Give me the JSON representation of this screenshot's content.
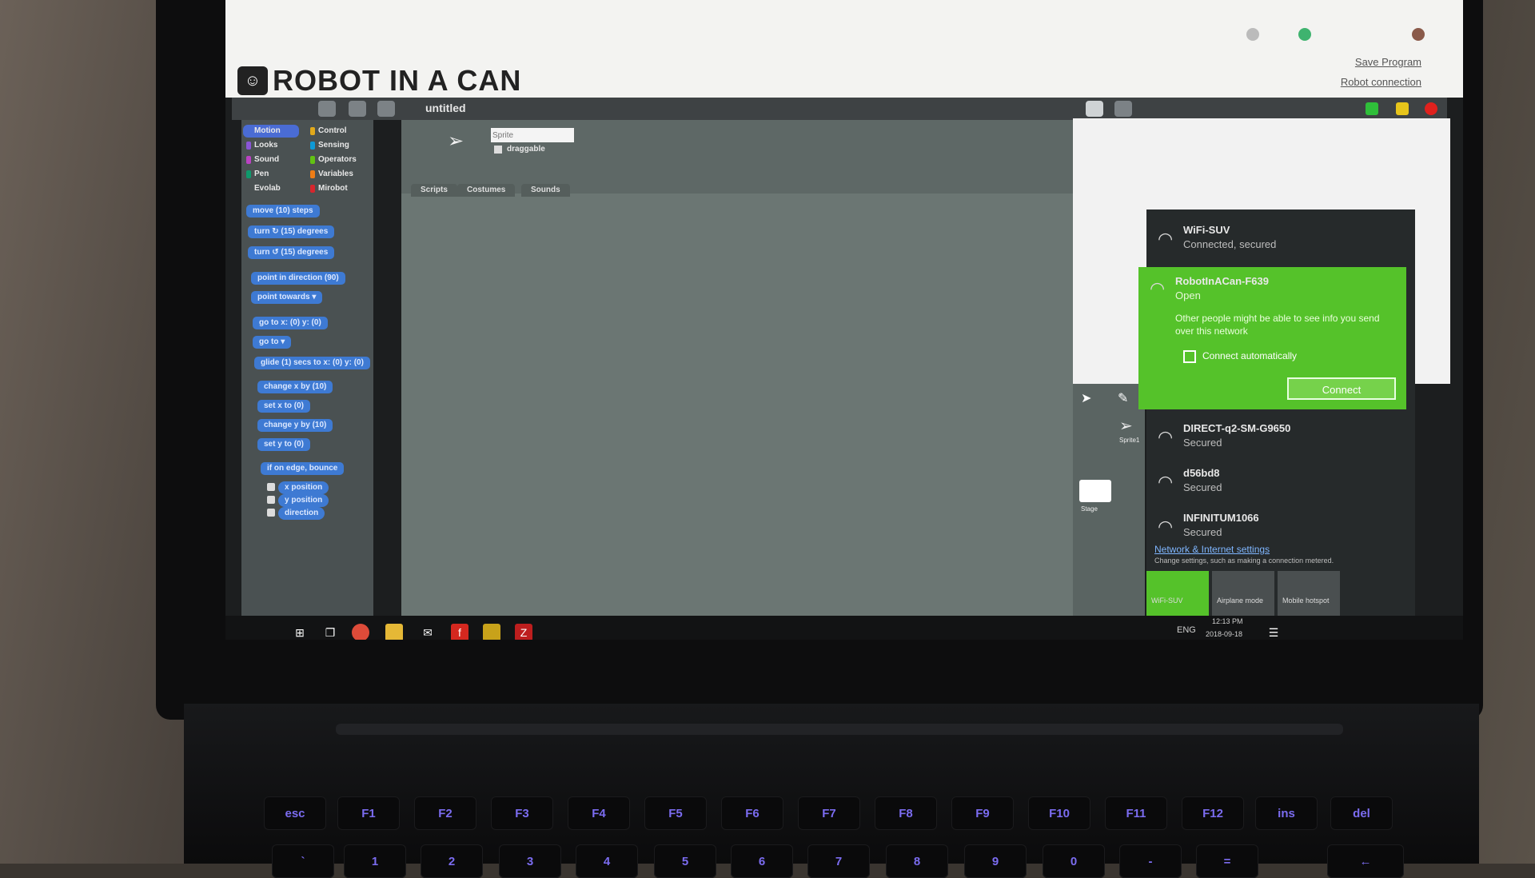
{
  "browser": {
    "logo_text": "ROBOT IN A CAN",
    "save_program": "Save Program",
    "connection_link": "Robot connection"
  },
  "app": {
    "project_title": "untitled",
    "sprite_name_placeholder": "Sprite",
    "draggable_label": "draggable",
    "tabs": [
      "Scripts",
      "Costumes",
      "Sounds"
    ],
    "categories": [
      {
        "label": "Motion",
        "color": "#4a6cd4"
      },
      {
        "label": "Control",
        "color": "#e1a91a"
      },
      {
        "label": "Looks",
        "color": "#8a55d7"
      },
      {
        "label": "Sensing",
        "color": "#0e9ad6"
      },
      {
        "label": "Sound",
        "color": "#bb42c3"
      },
      {
        "label": "Operators",
        "color": "#62c213"
      },
      {
        "label": "Pen",
        "color": "#0e9a6c"
      },
      {
        "label": "Variables",
        "color": "#ee7d16"
      },
      {
        "label": "Evolab",
        "color": "#4a5152"
      },
      {
        "label": "Mirobot",
        "color": "#d6262d"
      }
    ],
    "blocks": [
      "move (10) steps",
      "turn ↻ (15) degrees",
      "turn ↺ (15) degrees",
      "point in direction (90)",
      "point towards ▾",
      "go to x: (0) y: (0)",
      "go to ▾",
      "glide (1) secs to x: (0) y: (0)",
      "change x by (10)",
      "set x to (0)",
      "change y by (10)",
      "set y to (0)",
      "if on edge, bounce"
    ],
    "reporters": [
      "x position",
      "y position",
      "direction"
    ],
    "stage_label": "Stage",
    "sprite_label": "Sprite1"
  },
  "wifi": {
    "networks": [
      {
        "name": "WiFi-SUV",
        "status": "Connected, secured"
      },
      {
        "name": "RobotInACan-F639",
        "status": "Open"
      },
      {
        "name": "DIRECT-q2-SM-G9650",
        "status": "Secured"
      },
      {
        "name": "d56bd8",
        "status": "Secured"
      },
      {
        "name": "INFINITUM1066",
        "status": "Secured"
      }
    ],
    "warning": "Other people might be able to see info you send over this network",
    "auto_connect": "Connect automatically",
    "connect_button": "Connect",
    "settings_link": "Network & Internet settings",
    "settings_desc": "Change settings, such as making a connection metered.",
    "quick_actions": [
      "WiFi-SUV",
      "Airplane mode",
      "Mobile hotspot"
    ],
    "accent_color": "#55c22a"
  },
  "taskbar": {
    "lang": "ENG",
    "time": "12:13 PM",
    "date": "2018-09-18"
  },
  "keyboard": {
    "row1": [
      "esc",
      "F1",
      "F2",
      "F3",
      "F4",
      "F5",
      "F6",
      "F7",
      "F8",
      "F9",
      "F10",
      "F11",
      "F12",
      "ins",
      "del"
    ],
    "row2": [
      "`",
      "1",
      "2",
      "3",
      "4",
      "5",
      "6",
      "7",
      "8",
      "9",
      "0",
      "-",
      "=",
      "←"
    ]
  }
}
